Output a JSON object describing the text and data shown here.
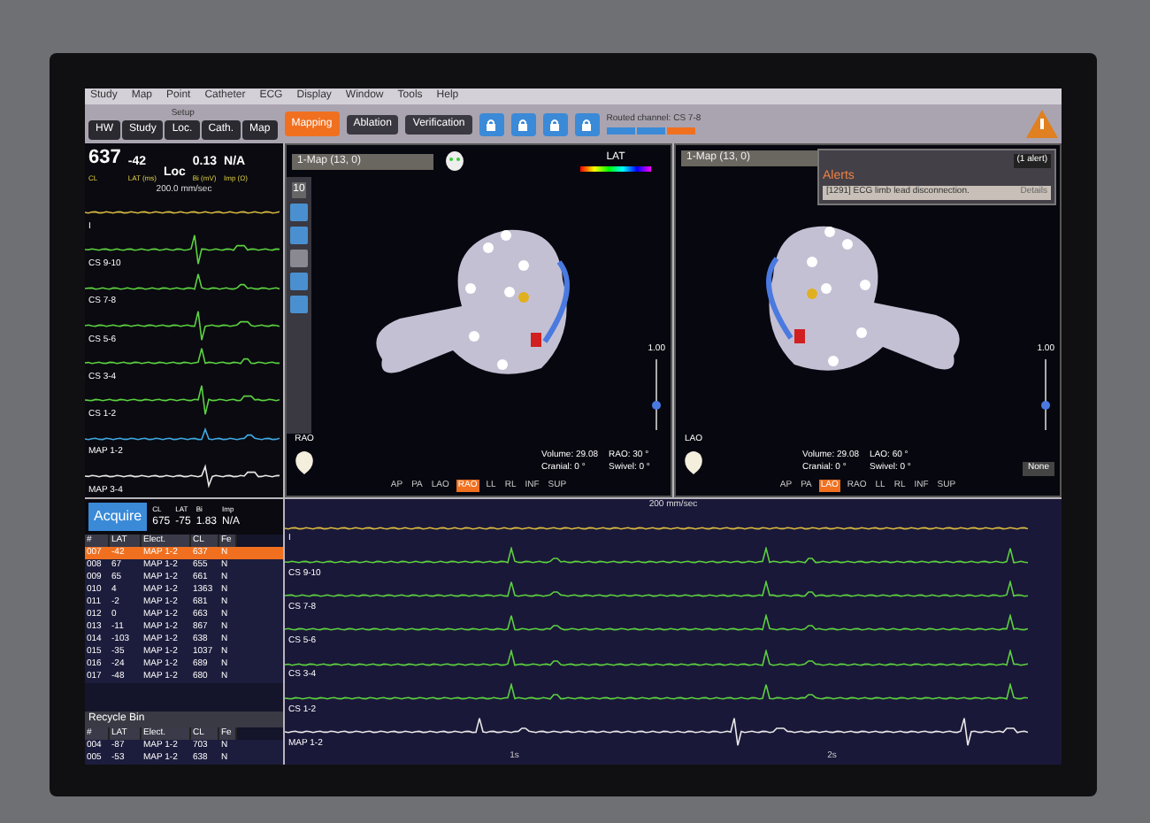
{
  "menu": [
    "Study",
    "Map",
    "Point",
    "Catheter",
    "ECG",
    "Display",
    "Window",
    "Tools",
    "Help"
  ],
  "setup": {
    "label": "Setup",
    "tabs": [
      {
        "label": "HW",
        "selected": false
      },
      {
        "label": "Study",
        "selected": false
      },
      {
        "label": "Loc.",
        "selected": false
      },
      {
        "label": "Cath.",
        "selected": false
      },
      {
        "label": "Map",
        "selected": false
      }
    ]
  },
  "mode_tabs": [
    {
      "label": "Mapping",
      "selected": true
    },
    {
      "label": "Ablation",
      "selected": false
    },
    {
      "label": "Verification",
      "selected": false
    }
  ],
  "routed_channel": {
    "label": "Routed channel:",
    "value": "CS 7-8"
  },
  "ecg_panel": {
    "readouts": [
      {
        "value": "637",
        "label": "CL"
      },
      {
        "value": "-42",
        "label": "LAT (ms)"
      },
      {
        "value": "Loc"
      },
      {
        "value": "0.13",
        "label": "Bi (mV)"
      },
      {
        "value": "N/A",
        "label": "Imp (Ω)"
      }
    ],
    "speed": "200.0 mm/sec",
    "channels": [
      {
        "name": "I",
        "color": "#d8b840"
      },
      {
        "name": "CS 9-10",
        "color": "#5cd040"
      },
      {
        "name": "CS 7-8",
        "color": "#5cd040"
      },
      {
        "name": "CS 5-6",
        "color": "#5cd040"
      },
      {
        "name": "CS 3-4",
        "color": "#5cd040"
      },
      {
        "name": "CS 1-2",
        "color": "#5cd040"
      },
      {
        "name": "MAP 1-2",
        "color": "#40a8e0"
      },
      {
        "name": "MAP 3-4",
        "color": "#e8e8e8"
      }
    ]
  },
  "tool_value": "10",
  "maps": [
    {
      "title": "1-Map (13, 0)",
      "legend": "LAT",
      "orientation": "RAO",
      "scale": "1.00",
      "stats": [
        {
          "label": "Volume:",
          "value": "29.08"
        },
        {
          "label": "RAO:",
          "value": "30 °"
        },
        {
          "label": "Cranial:",
          "value": "0 °"
        },
        {
          "label": "Swivel:",
          "value": "0 °"
        }
      ],
      "views": [
        {
          "label": "AP",
          "selected": false
        },
        {
          "label": "PA",
          "selected": false
        },
        {
          "label": "LAO",
          "selected": false
        },
        {
          "label": "RAO",
          "selected": true
        },
        {
          "label": "LL",
          "selected": false
        },
        {
          "label": "RL",
          "selected": false
        },
        {
          "label": "INF",
          "selected": false
        },
        {
          "label": "SUP",
          "selected": false
        }
      ]
    },
    {
      "title": "1-Map (13, 0)",
      "orientation": "LAO",
      "scale": "1.00",
      "stats": [
        {
          "label": "Volume:",
          "value": "29.08"
        },
        {
          "label": "LAO:",
          "value": "60 °"
        },
        {
          "label": "Cranial:",
          "value": "0 °"
        },
        {
          "label": "Swivel:",
          "value": "0 °"
        }
      ],
      "views": [
        {
          "label": "AP",
          "selected": false
        },
        {
          "label": "PA",
          "selected": false
        },
        {
          "label": "LAO",
          "selected": true
        },
        {
          "label": "RAO",
          "selected": false
        },
        {
          "label": "LL",
          "selected": false
        },
        {
          "label": "RL",
          "selected": false
        },
        {
          "label": "INF",
          "selected": false
        },
        {
          "label": "SUP",
          "selected": false
        }
      ],
      "dropdown": "None"
    }
  ],
  "alerts": {
    "title": "Alerts",
    "count": "(1 alert)",
    "message": "[1291] ECG limb lead disconnection.",
    "details": "Details"
  },
  "acquire": {
    "button": "Acquire",
    "readouts": [
      {
        "label": "CL",
        "value": "675"
      },
      {
        "label": "LAT",
        "value": "-75"
      },
      {
        "label": "Bi",
        "value": "1.83"
      },
      {
        "label": "Imp",
        "value": "N/A"
      }
    ]
  },
  "points_table": {
    "columns": [
      "#",
      "LAT",
      "Elect.",
      "CL",
      "Fe"
    ],
    "rows": [
      {
        "cells": [
          "007",
          "-42",
          "MAP 1-2",
          "637",
          "N"
        ],
        "selected": true
      },
      {
        "cells": [
          "008",
          "67",
          "MAP 1-2",
          "655",
          "N"
        ],
        "selected": false
      },
      {
        "cells": [
          "009",
          "65",
          "MAP 1-2",
          "661",
          "N"
        ],
        "selected": false
      },
      {
        "cells": [
          "010",
          "4",
          "MAP 1-2",
          "1363",
          "N"
        ],
        "selected": false
      },
      {
        "cells": [
          "011",
          "-2",
          "MAP 1-2",
          "681",
          "N"
        ],
        "selected": false
      },
      {
        "cells": [
          "012",
          "0",
          "MAP 1-2",
          "663",
          "N"
        ],
        "selected": false
      },
      {
        "cells": [
          "013",
          "-11",
          "MAP 1-2",
          "867",
          "N"
        ],
        "selected": false
      },
      {
        "cells": [
          "014",
          "-103",
          "MAP 1-2",
          "638",
          "N"
        ],
        "selected": false
      },
      {
        "cells": [
          "015",
          "-35",
          "MAP 1-2",
          "1037",
          "N"
        ],
        "selected": false
      },
      {
        "cells": [
          "016",
          "-24",
          "MAP 1-2",
          "689",
          "N"
        ],
        "selected": false
      },
      {
        "cells": [
          "017",
          "-48",
          "MAP 1-2",
          "680",
          "N"
        ],
        "selected": false
      }
    ]
  },
  "recycle_bin": {
    "title": "Recycle Bin",
    "columns": [
      "#",
      "LAT",
      "Elect.",
      "CL",
      "Fe"
    ],
    "rows": [
      {
        "cells": [
          "004",
          "-87",
          "MAP 1-2",
          "703",
          "N"
        ]
      },
      {
        "cells": [
          "005",
          "-53",
          "MAP 1-2",
          "638",
          "N"
        ]
      }
    ]
  },
  "strip": {
    "speed": "200 mm/sec",
    "channels": [
      {
        "name": "I",
        "color": "#d8b840"
      },
      {
        "name": "CS 9-10",
        "color": "#5cd040"
      },
      {
        "name": "CS 7-8",
        "color": "#5cd040"
      },
      {
        "name": "CS 5-6",
        "color": "#5cd040"
      },
      {
        "name": "CS 3-4",
        "color": "#5cd040"
      },
      {
        "name": "CS 1-2",
        "color": "#5cd040"
      },
      {
        "name": "MAP 1-2",
        "color": "#e8e8e8"
      }
    ],
    "ticks": [
      "1s",
      "2s"
    ]
  }
}
